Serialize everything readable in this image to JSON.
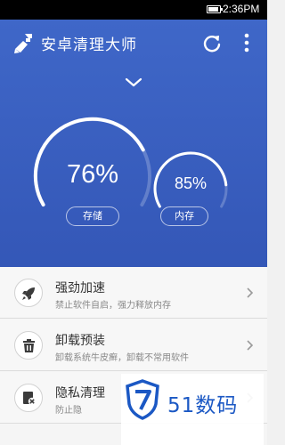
{
  "status_bar": {
    "time": "2:36PM",
    "battery_level": 0.85
  },
  "app": {
    "title": "安卓清理大师"
  },
  "gauges": [
    {
      "value": "76%",
      "label": "存储",
      "fraction": 0.76
    },
    {
      "value": "85%",
      "label": "内存",
      "fraction": 0.85
    }
  ],
  "items": [
    {
      "title": "强劲加速",
      "subtitle": "禁止软件自启，强力释放内存",
      "icon": "rocket-icon"
    },
    {
      "title": "卸载预装",
      "subtitle": "卸载系统牛皮癣，卸载不常用软件",
      "icon": "trash-icon"
    },
    {
      "title": "隐私清理",
      "subtitle": "防止隐",
      "icon": "privacy-icon"
    }
  ],
  "watermark": {
    "text": "51数码"
  },
  "colors": {
    "header_blue": "#3f67c8",
    "accent_blue": "#1b58c4"
  }
}
